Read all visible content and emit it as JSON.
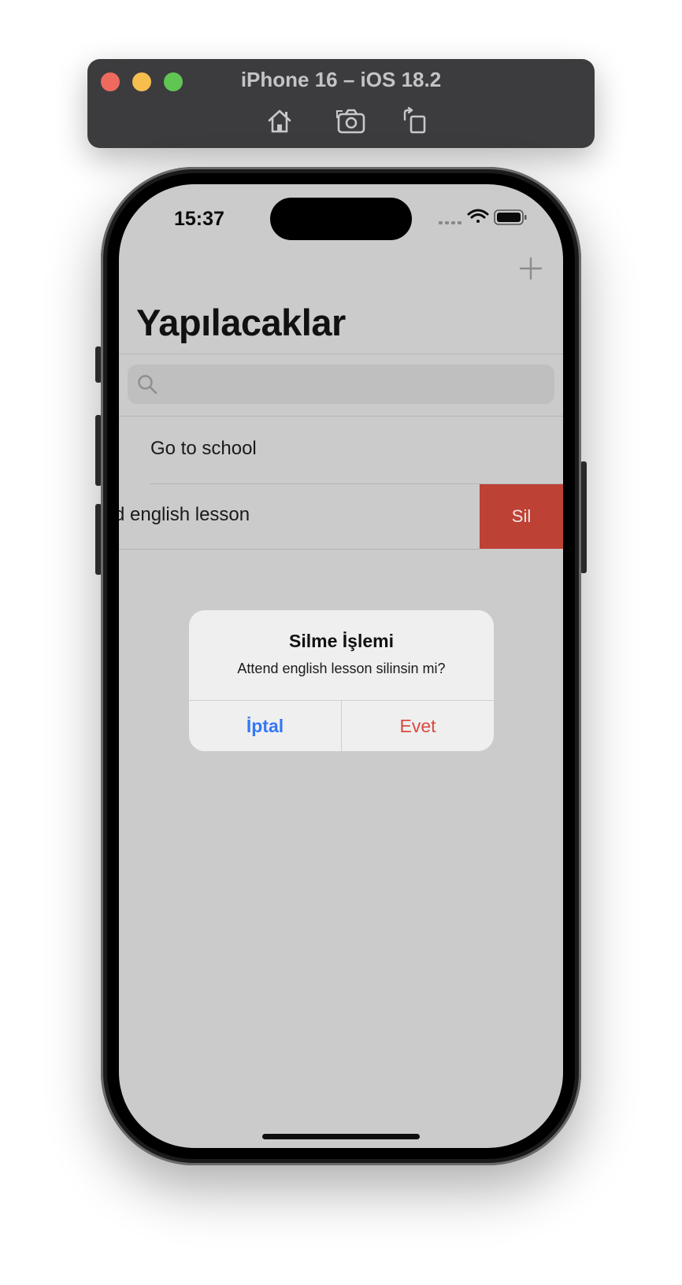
{
  "simulator": {
    "title": "iPhone 16 – iOS 18.2",
    "toolbar_icons": [
      "home-icon",
      "screenshot-icon",
      "rotate-icon"
    ]
  },
  "status_bar": {
    "time": "15:37",
    "icons": [
      "cellular-icon",
      "wifi-icon",
      "battery-icon"
    ]
  },
  "nav": {
    "title": "Yapılacaklar",
    "add_icon": "plus-icon"
  },
  "search": {
    "placeholder": "",
    "value": "",
    "icon": "search-icon"
  },
  "list": {
    "items": [
      {
        "text": "Go to school"
      },
      {
        "text": "d english lesson",
        "swipe_action": "Sil"
      }
    ]
  },
  "alert": {
    "title": "Silme İşlemi",
    "message": "Attend english lesson silinsin mi?",
    "cancel_label": "İptal",
    "confirm_label": "Evet"
  },
  "colors": {
    "destructive": "#be4135",
    "accent_blue": "#3478f6",
    "confirm_red": "#d94a3f"
  }
}
